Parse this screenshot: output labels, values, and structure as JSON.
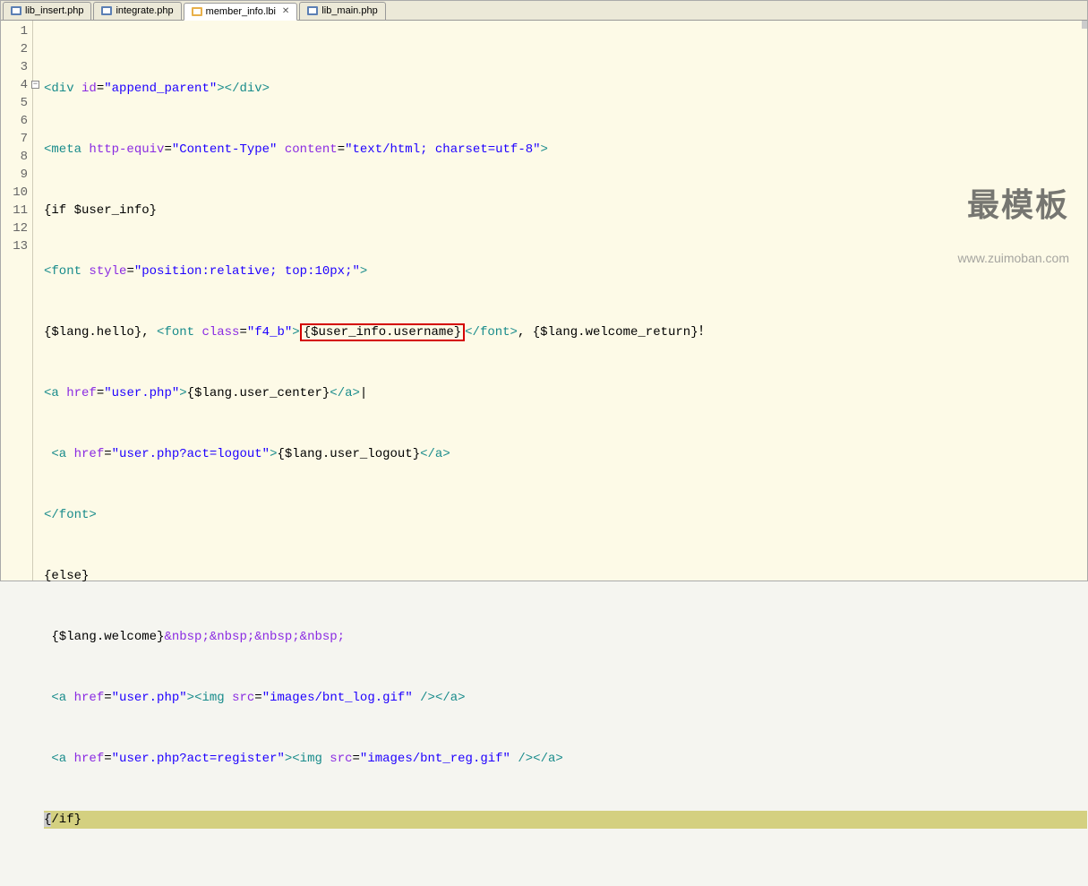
{
  "tabs": [
    {
      "label": "lib_insert.php",
      "icon": "php"
    },
    {
      "label": "integrate.php",
      "icon": "php"
    },
    {
      "label": "member_info.lbi",
      "icon": "lbi",
      "active": true
    },
    {
      "label": "lib_main.php",
      "icon": "php"
    }
  ],
  "watermark": {
    "title": "最模板",
    "url": "www.zuimoban.com"
  },
  "code": {
    "lines": [
      "1",
      "2",
      "3",
      "4",
      "5",
      "6",
      "7",
      "8",
      "9",
      "10",
      "11",
      "12",
      "13"
    ],
    "l1": {
      "t1": "<div",
      "a1": "id",
      "eq": "=",
      "v1": "\"append_parent\"",
      "t2": "></div>"
    },
    "l2": {
      "t1": "<meta",
      "a1": "http-equiv",
      "v1": "\"Content-Type\"",
      "a2": "content",
      "v2": "\"text/html; charset=utf-8\"",
      "t2": ">"
    },
    "l3": {
      "t": "{if $user_info}"
    },
    "l4": {
      "t1": "<font",
      "a1": "style",
      "v1": "\"position:relative; top:10px;\"",
      "t2": ">"
    },
    "l5": {
      "p1": "{$lang.hello}",
      "c1": ", ",
      "t1": "<font",
      "a1": "class",
      "v1": "\"f4_b\"",
      "gt": ">",
      "boxed": "{$user_info.username}",
      "t2": "</font>",
      "c2": ", ",
      "p2": "{$lang.welcome_return}",
      "excl": "！"
    },
    "l6": {
      "t1": "<a",
      "a1": "href",
      "v1": "\"user.php\"",
      "gt": ">",
      "p": "{$lang.user_center}",
      "t2": "</a>",
      "bar": "|"
    },
    "l7": {
      "sp": " ",
      "t1": "<a",
      "a1": "href",
      "v1": "\"user.php?act=logout\"",
      "gt": ">",
      "p": "{$lang.user_logout}",
      "t2": "</a>"
    },
    "l8": {
      "t": "</font>"
    },
    "l9": {
      "t": "{else}"
    },
    "l10": {
      "sp": " ",
      "p": "{$lang.welcome}",
      "n": "&nbsp;&nbsp;&nbsp;&nbsp;"
    },
    "l11": {
      "sp": " ",
      "t1": "<a",
      "a1": "href",
      "v1": "\"user.php\"",
      "gt": ">",
      "t2": "<img",
      "a2": "src",
      "v2": "\"images/bnt_log.gif\"",
      "t3": "/></a>"
    },
    "l12": {
      "sp": " ",
      "t1": "<a",
      "a1": "href",
      "v1": "\"user.php?act=register\"",
      "gt": ">",
      "t2": "<img",
      "a2": "src",
      "v2": "\"images/bnt_reg.gif\"",
      "t3": "/></a>"
    },
    "l13": {
      "open": "{",
      "rest": "/if}"
    }
  }
}
